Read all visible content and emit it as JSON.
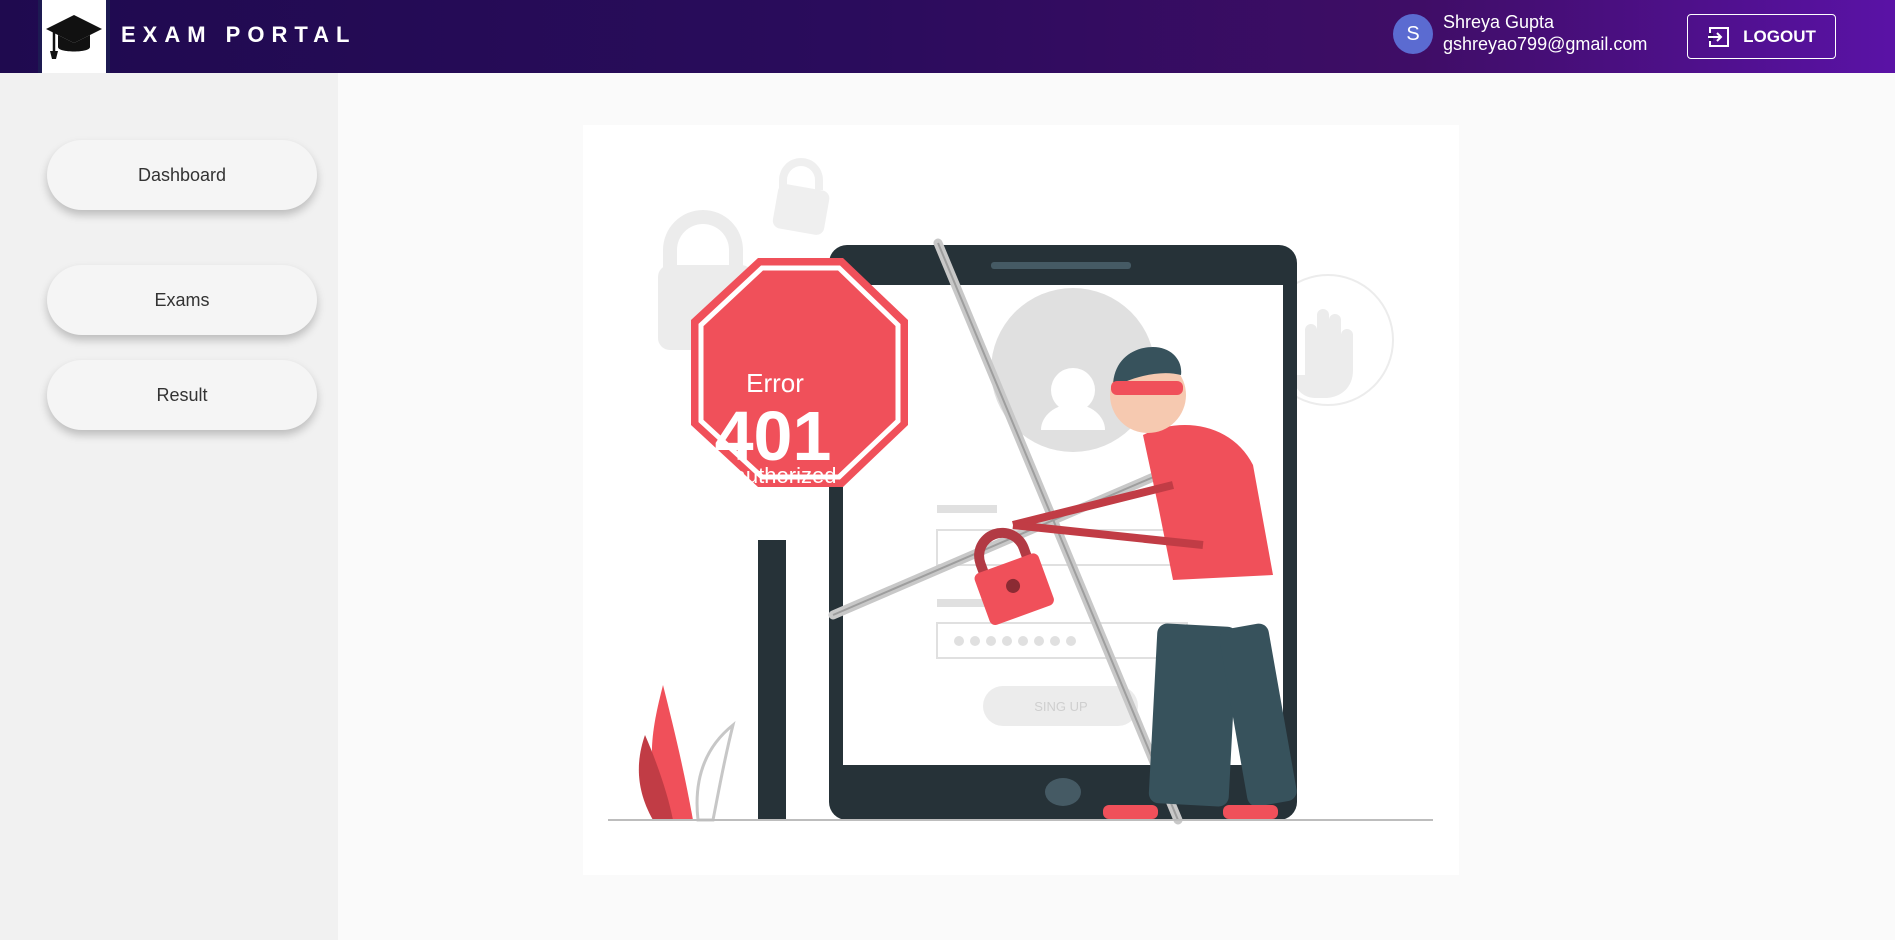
{
  "header": {
    "app_title": "EXAM PORTAL",
    "logo_icon": "graduation-cap-icon",
    "user": {
      "avatar_letter": "S",
      "name": "Shreya Gupta",
      "email": "gshreyao799@gmail.com"
    },
    "logout_label": "LOGOUT",
    "logout_icon": "logout-icon"
  },
  "sidebar": {
    "items": [
      {
        "label": "Dashboard"
      },
      {
        "label": "Exams"
      },
      {
        "label": "Result"
      }
    ]
  },
  "main": {
    "illustration": {
      "sign_error": "Error",
      "sign_code": "401",
      "sign_status": "Unauthorized",
      "form_button": "SING UP"
    }
  },
  "colors": {
    "header_gradient_start": "#1f0a4f",
    "header_gradient_end": "#5a12a6",
    "sign_red": "#f0505a",
    "tablet_dark": "#263238"
  }
}
